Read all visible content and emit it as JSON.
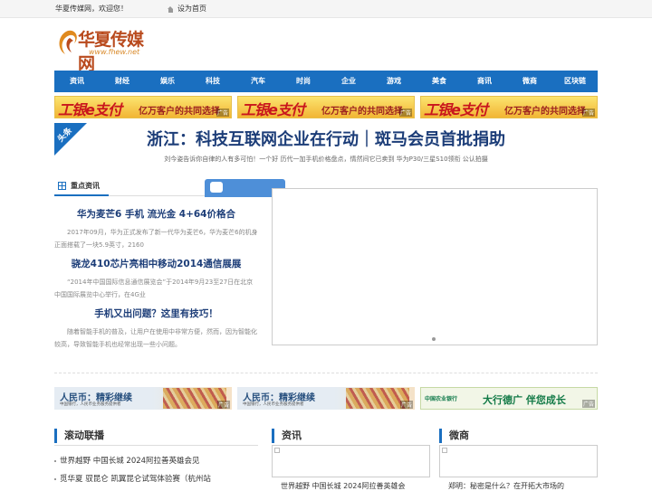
{
  "topbar": {
    "welcome": "华夏传媒网，欢迎您！",
    "set_home": "设为首页"
  },
  "logo": {
    "name": "华夏传媒网",
    "url": "www.fhew.net"
  },
  "nav": [
    "资讯",
    "财经",
    "娱乐",
    "科技",
    "汽车",
    "时尚",
    "企业",
    "游戏",
    "美食",
    "商讯",
    "微商",
    "区块链"
  ],
  "top_banners": [
    {
      "main": "工银e支付",
      "slogan": "亿万客户的共同选择",
      "ad": "广告"
    },
    {
      "main": "工银e支付",
      "slogan": "亿万客户的共同选择",
      "ad": "广告"
    },
    {
      "main": "工银e支付",
      "slogan": "亿万客户的共同选择",
      "ad": "广告"
    }
  ],
  "headline": {
    "tag": "头条",
    "title": "浙江：科技互联网企业在行动｜斑马会员首批捐助",
    "sub": "刘今姿告诉你自律的人有多可怕！一个好   历代一加手机价格盘点，情然间它已卖到   华为P30/三星S10领衔 公认拍摄"
  },
  "focus": {
    "tab": "重点资讯",
    "items": [
      {
        "title": "华为麦芒6 手机 流光金 4+64价格合",
        "summary": "2017年09月，华为正式发布了新一代华为麦芒6，华为麦芒6的机身正面搭载了一块5.9英寸，2160"
      },
      {
        "title": "骁龙410芯片亮相中移动2014通信展展",
        "summary": "“2014年中国国际信息通信展览会”于2014年9月23至27日在北京中国国际展览中心举行，在4G业"
      },
      {
        "title": "手机又出问题？这里有技巧！",
        "summary": "随着智能手机的普及，让用户在使用中非常方便，然而，因为智能化较高，导致智能手机也经常出现一些小问题。"
      }
    ]
  },
  "mid_banners": [
    {
      "type": "rmb",
      "title": "人民币：精彩继续",
      "sub": "中国银行，人民币业务服务提供者",
      "ad": "广告"
    },
    {
      "type": "rmb",
      "title": "人民币：精彩继续",
      "sub": "中国银行，人民币业务服务提供者",
      "ad": "广告"
    },
    {
      "type": "abc",
      "bank": "中国农业银行",
      "title": "大行德广 伴您成长",
      "ad": "广告"
    }
  ],
  "sections": {
    "roll": {
      "title": "滚动联播",
      "items": [
        "世界越野 中国长城 2024阿拉善英雄会见",
        "觅华夏 驭昆仑 凯翼昆仑试驾体验赛（杭州站"
      ]
    },
    "news": {
      "title": "资讯",
      "caption": "世界越野 中国长城 2024阿拉善英雄会"
    },
    "wechat": {
      "title": "微商",
      "caption": "郑明：秘密是什么？在开拓大市场的"
    }
  }
}
